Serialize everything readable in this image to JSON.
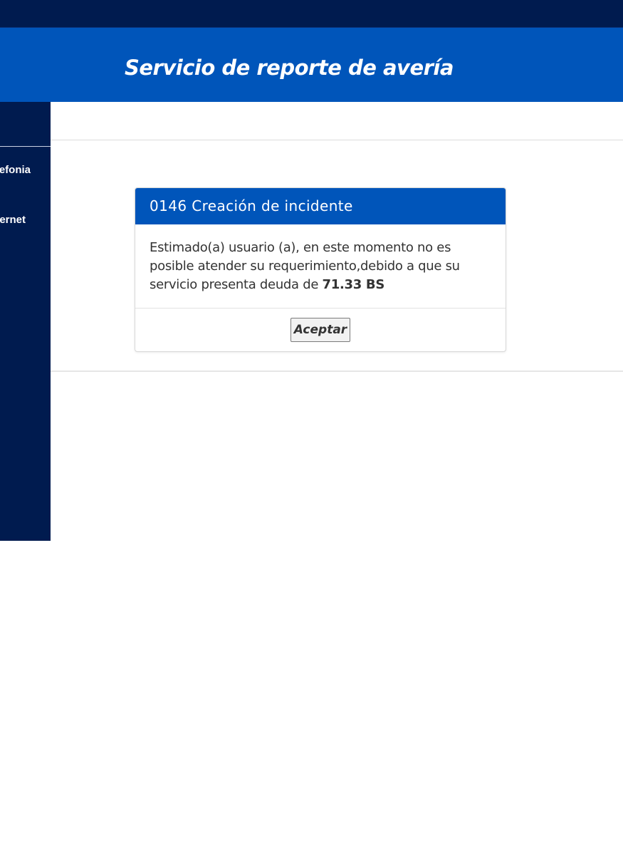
{
  "header": {
    "title": "Servicio de reporte de avería"
  },
  "sidebar": {
    "items": [
      {
        "label": "efonia"
      },
      {
        "label": "ernet"
      }
    ]
  },
  "modal": {
    "title": "0146 Creación de incidente",
    "message_text": "Estimado(a) usuario (a), en este momento no es posible atender su requerimiento,debido a que su servicio presenta deuda de ",
    "amount": "71.33 BS",
    "accept_label": "Aceptar"
  },
  "colors": {
    "top_bar": "#001b4f",
    "brand_blue": "#0055ba",
    "sidebar": "#001b4f"
  }
}
